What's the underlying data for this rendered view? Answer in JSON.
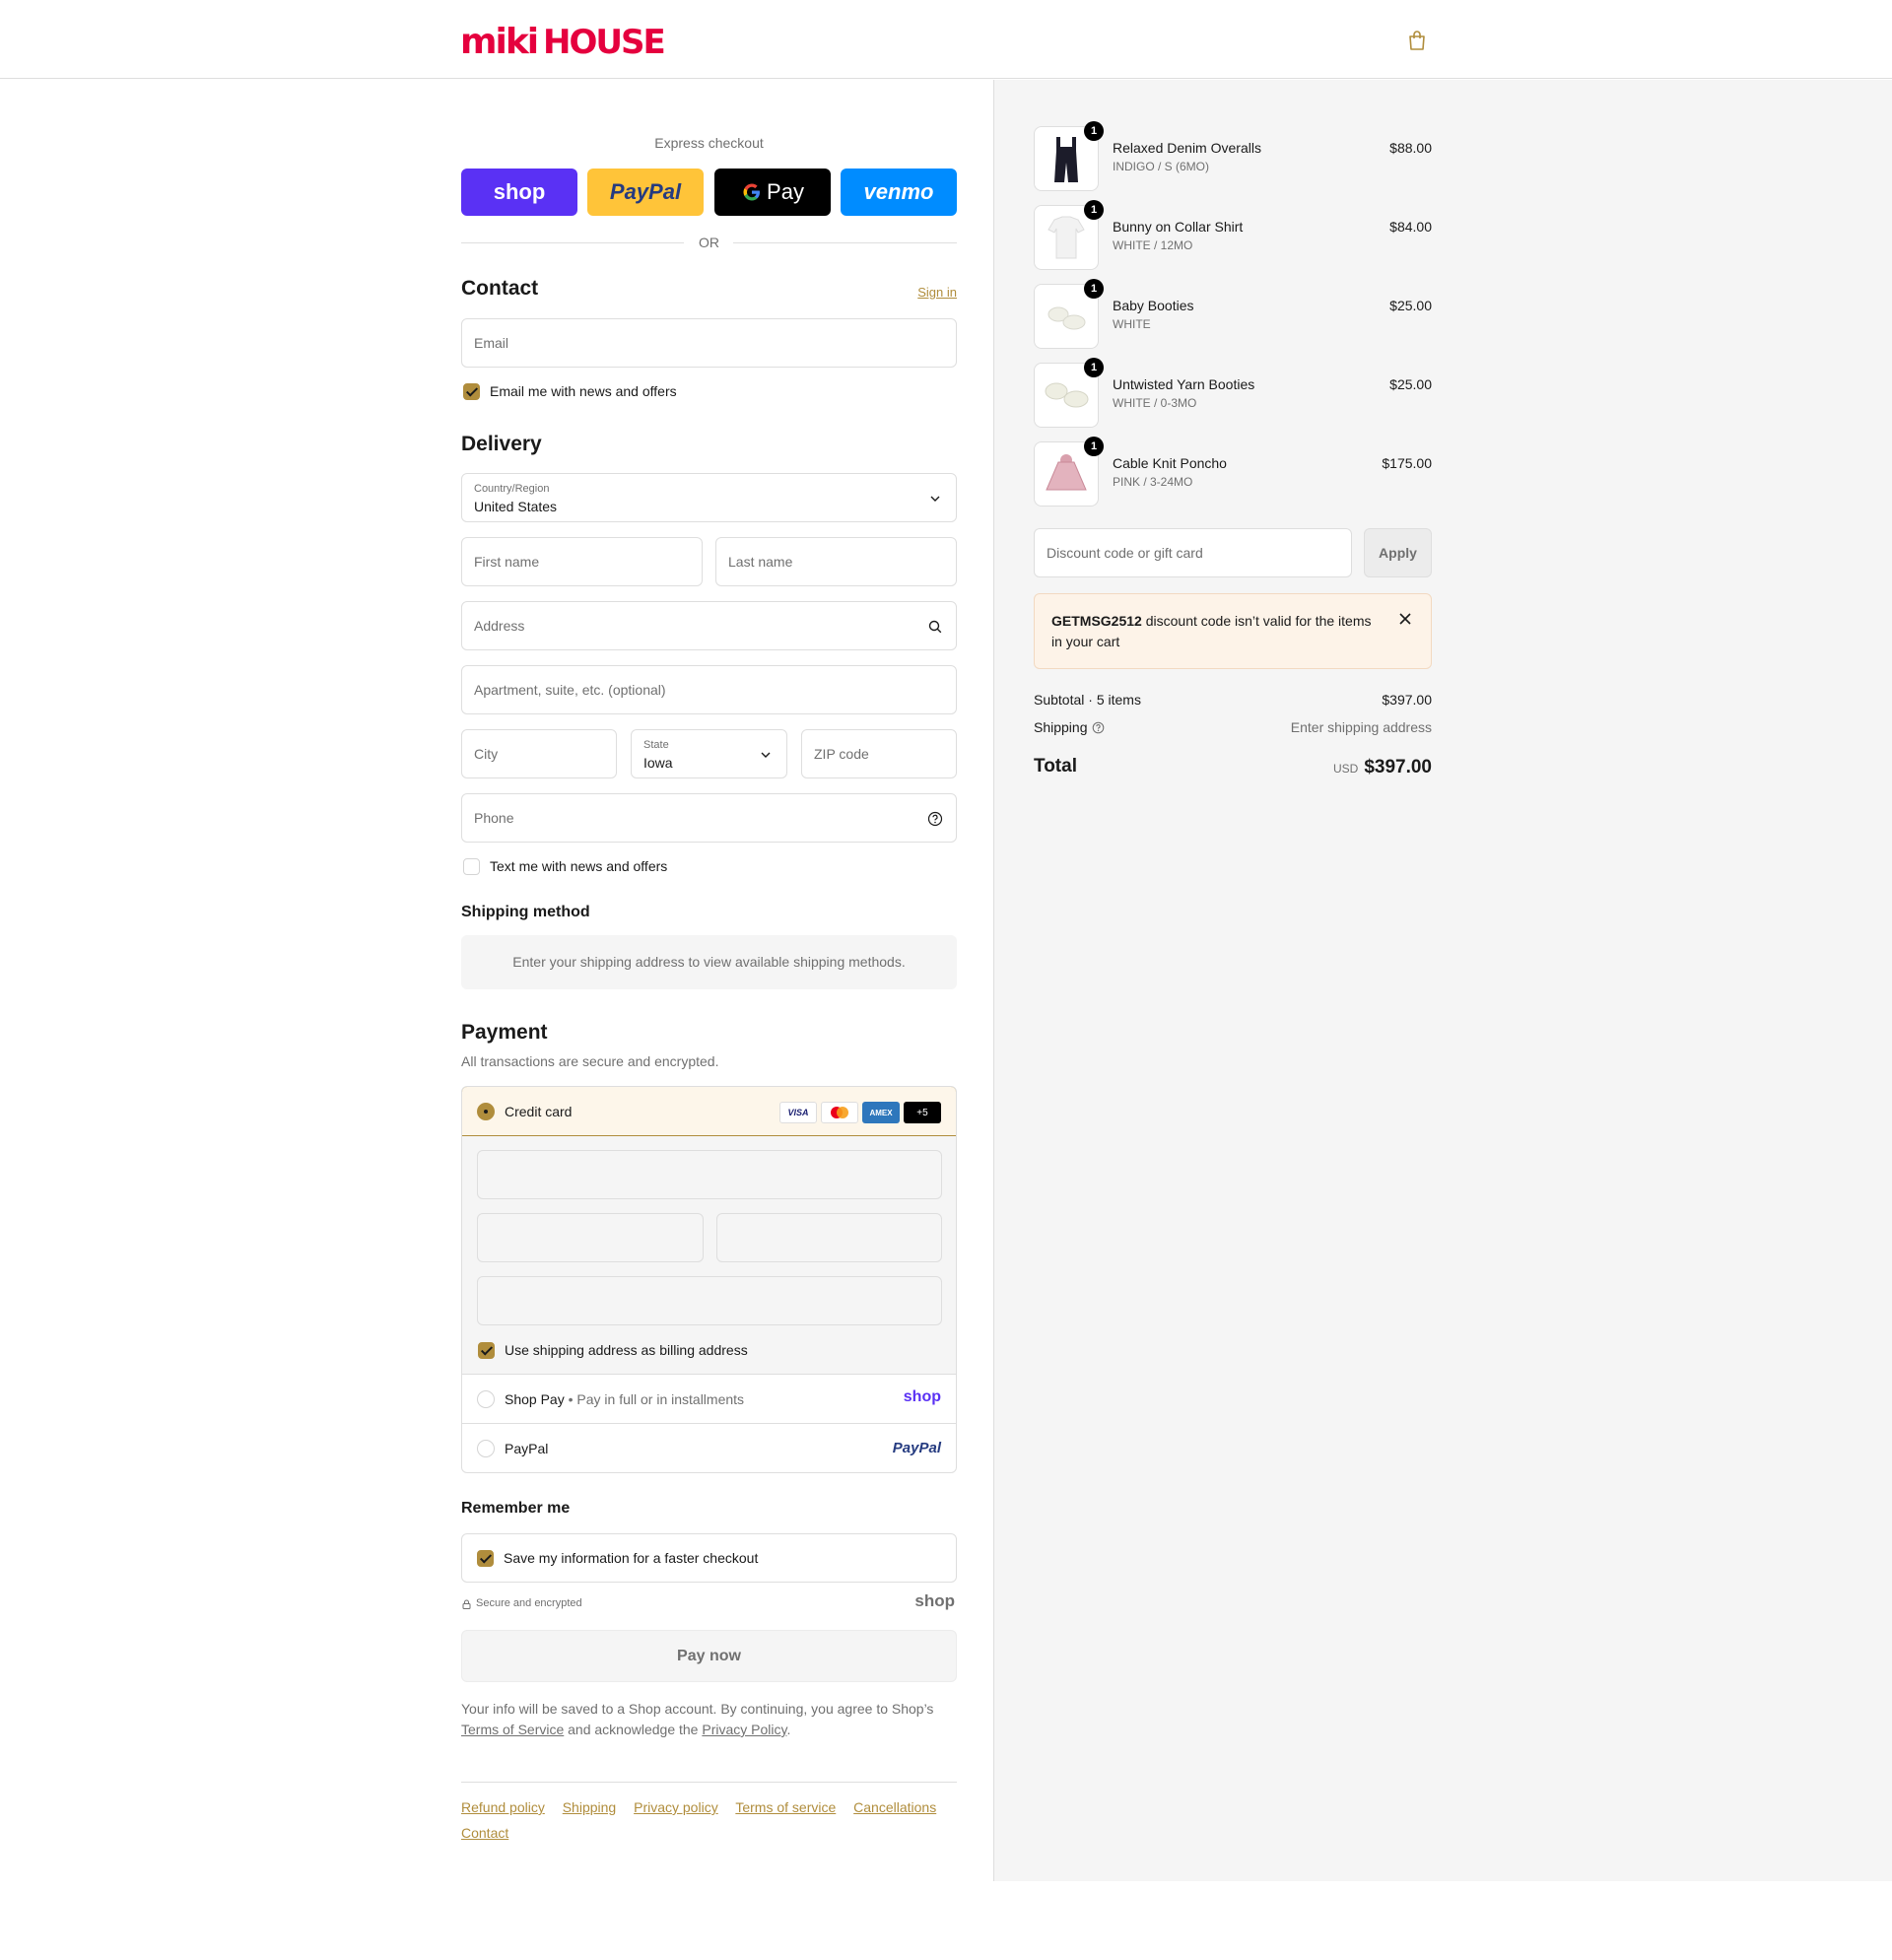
{
  "brand": {
    "name": "MIKI HOUSE",
    "logo_text": "mikiHOUSE",
    "accent": "#b08d3c",
    "logo_red": "#e5003e"
  },
  "express": {
    "label": "Express checkout",
    "buttons": [
      {
        "name": "shop",
        "label": "shop",
        "bg": "#5a31f4",
        "fg": "#ffffff"
      },
      {
        "name": "paypal",
        "label": "PayPal",
        "bg": "#ffc439",
        "fg": "#253b80"
      },
      {
        "name": "gpay",
        "label": "Pay",
        "bg": "#000000",
        "fg": "#ffffff"
      },
      {
        "name": "venmo",
        "label": "venmo",
        "bg": "#008cff",
        "fg": "#ffffff"
      }
    ],
    "or": "OR"
  },
  "contact": {
    "title": "Contact",
    "sign_in": "Sign in",
    "email_placeholder": "Email",
    "email_opt_in": "Email me with news and offers"
  },
  "delivery": {
    "title": "Delivery",
    "country_label": "Country/Region",
    "country_value": "United States",
    "first_name": "First name",
    "last_name": "Last name",
    "address": "Address",
    "apartment": "Apartment, suite, etc. (optional)",
    "city": "City",
    "state_label": "State",
    "state_value": "Iowa",
    "zip": "ZIP code",
    "phone": "Phone",
    "text_opt_in": "Text me with news and offers"
  },
  "shipping_method": {
    "title": "Shipping method",
    "notice": "Enter your shipping address to view available shipping methods."
  },
  "payment": {
    "title": "Payment",
    "subtitle": "All transactions are secure and encrypted.",
    "credit_card": "Credit card",
    "card_brands": [
      "VISA",
      "MC",
      "AMEX",
      "+5"
    ],
    "billing_same": "Use shipping address as billing address",
    "shop_pay": "Shop Pay",
    "shop_pay_sub": "Pay in full or in installments",
    "shop_pay_logo": "shop",
    "paypal": "PayPal",
    "paypal_logo": "PayPal"
  },
  "remember": {
    "title": "Remember me",
    "save_info": "Save my information for a faster checkout",
    "secure": "Secure and encrypted",
    "shop_logo": "shop"
  },
  "pay_button": "Pay now",
  "legal": {
    "text1": "Your info will be saved to a Shop account. By continuing, you agree to Shop’s",
    "tos": "Terms of Service",
    "text2": "and acknowledge the",
    "privacy": "Privacy Policy",
    "text3": "."
  },
  "footer_links": [
    "Refund policy",
    "Shipping",
    "Privacy policy",
    "Terms of service",
    "Cancellations",
    "Contact"
  ],
  "cart": {
    "items": [
      {
        "name": "Relaxed Denim Overalls",
        "variant": "INDIGO / S (6MO)",
        "price": "$88.00",
        "qty": "1"
      },
      {
        "name": "Bunny on Collar Shirt",
        "variant": "WHITE / 12MO",
        "price": "$84.00",
        "qty": "1"
      },
      {
        "name": "Baby Booties",
        "variant": "WHITE",
        "price": "$25.00",
        "qty": "1"
      },
      {
        "name": "Untwisted Yarn Booties",
        "variant": "WHITE / 0-3MO",
        "price": "$25.00",
        "qty": "1"
      },
      {
        "name": "Cable Knit Poncho",
        "variant": "PINK / 3-24MO",
        "price": "$175.00",
        "qty": "1"
      }
    ],
    "discount_placeholder": "Discount code or gift card",
    "apply": "Apply",
    "error_code": "GETMSG2512",
    "error_text": "discount code isn’t valid for the items in your cart",
    "subtotal_label": "Subtotal · 5 items",
    "subtotal": "$397.00",
    "shipping_label": "Shipping",
    "shipping_value": "Enter shipping address",
    "total_label": "Total",
    "currency": "USD",
    "total": "$397.00"
  }
}
